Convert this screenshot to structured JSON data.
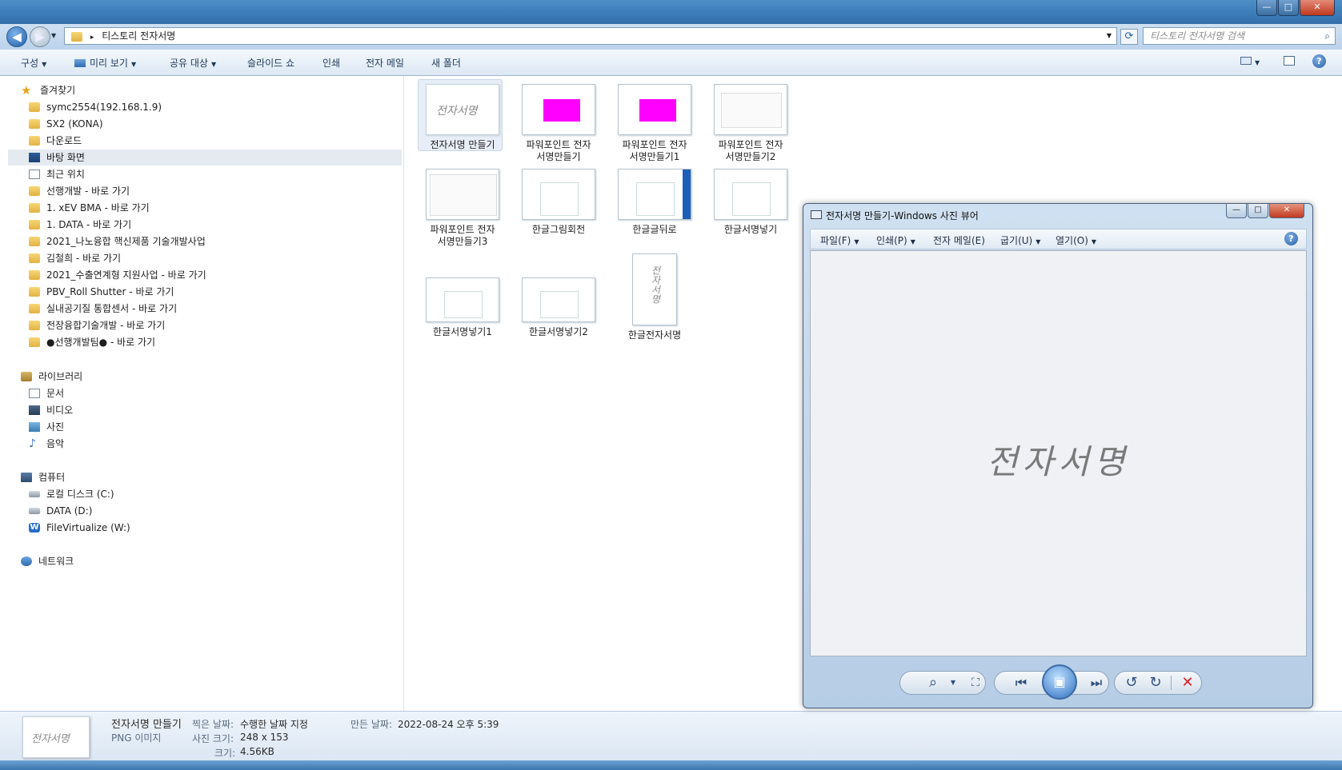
{
  "window": {
    "controls": [
      "—",
      "□",
      "✕"
    ]
  },
  "address": {
    "path_icon": "folder-icon",
    "crumb_sep": "▸",
    "path": "티스토리 전자서명",
    "search_placeholder": "티스토리 전자서명 검색"
  },
  "toolbar": {
    "items": [
      {
        "label": "구성",
        "dropdown": true
      },
      {
        "label": "미리 보기",
        "dropdown": true
      },
      {
        "label": "공유 대상",
        "dropdown": true
      },
      {
        "label": "슬라이드 쇼",
        "dropdown": false
      },
      {
        "label": "인쇄",
        "dropdown": false
      },
      {
        "label": "전자 메일",
        "dropdown": false
      },
      {
        "label": "새 폴더",
        "dropdown": false
      }
    ]
  },
  "nav": {
    "favorites": {
      "label": "즐겨찾기",
      "items": [
        "symc2554(192.168.1.9)",
        "SX2 (KONA)",
        "다운로드",
        "바탕 화면",
        "최근 위치",
        "선행개발 - 바로 가기",
        "1. xEV BMA - 바로 가기",
        "1. DATA - 바로 가기",
        "2021_나노융합 핵신제품 기술개발사업",
        "김철희 - 바로 가기",
        "2021_수출연계형 지원사업 - 바로 가기",
        "PBV_Roll Shutter - 바로 가기",
        "실내공기질 통합센서 - 바로 가기",
        "전장융합기술개발 - 바로 가기",
        "●선행개발팀● - 바로 가기"
      ]
    },
    "libraries": {
      "label": "라이브러리",
      "items": [
        "문서",
        "비디오",
        "사진",
        "음악"
      ]
    },
    "computer": {
      "label": "컴퓨터",
      "items": [
        "로컬 디스크 (C:)",
        "DATA (D:)",
        "FileVirtualize (W:)"
      ]
    },
    "network": {
      "label": "네트워크"
    }
  },
  "files": [
    {
      "line1": "전자서명 만들기",
      "line2": "",
      "selected": true,
      "kind": "signature"
    },
    {
      "line1": "파워포인트 전자",
      "line2": "서명만들기",
      "kind": "magenta"
    },
    {
      "line1": "파워포인트 전자",
      "line2": "서명만들기1",
      "kind": "magenta"
    },
    {
      "line1": "파워포인트 전자",
      "line2": "서명만들기2",
      "kind": "slide"
    },
    {
      "line1": "파워포인트 전자",
      "line2": "서명만들기3",
      "kind": "slide"
    },
    {
      "line1": "한글그림회전",
      "line2": "",
      "kind": "app"
    },
    {
      "line1": "한글글뒤로",
      "line2": "",
      "kind": "app"
    },
    {
      "line1": "한글서명넣기",
      "line2": "",
      "kind": "app"
    },
    {
      "line1": "한글서명넣기1",
      "line2": "",
      "kind": "app"
    },
    {
      "line1": "한글서명넣기2",
      "line2": "",
      "kind": "app"
    },
    {
      "line1": "한글전자서명",
      "line2": "",
      "kind": "portrait"
    }
  ],
  "thumb_signature": "전자서명",
  "details": {
    "name": "전자서명 만들기",
    "type": "PNG 이미지",
    "taken_label": "찍은 날짜:",
    "taken_value": "수행한 날짜 지정",
    "dims_label": "사진 크기:",
    "dims_value": "248 x 153",
    "size_label": "크기:",
    "size_value": "4.56KB",
    "created_label": "만든 날짜:",
    "created_value": "2022-08-24 오후 5:39"
  },
  "viewer": {
    "title": "전자서명 만들기-Windows 사진 뷰어",
    "menu": [
      "파일(F)",
      "인쇄(P)",
      "전자 메일(E)",
      "굽기(U)",
      "열기(O)"
    ],
    "menu_dropdown": [
      true,
      true,
      false,
      true,
      true
    ],
    "help": "?",
    "signature": "전자서명",
    "controls": {
      "zoom": "⌕",
      "fit": "⛶",
      "prev": "⏮",
      "play": "▣",
      "next": "⏭",
      "rotate_ccw": "↺",
      "rotate_cw": "↻",
      "delete": "✕"
    }
  }
}
